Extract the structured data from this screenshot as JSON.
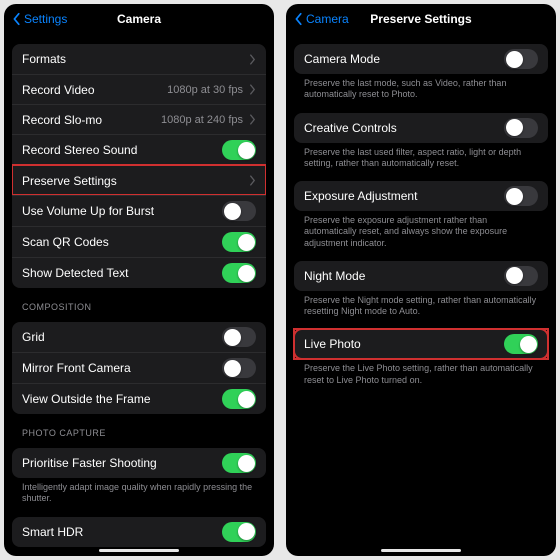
{
  "left": {
    "back": "Settings",
    "title": "Camera",
    "group1": [
      {
        "label": "Formats",
        "accessory": "chevron"
      },
      {
        "label": "Record Video",
        "value": "1080p at 30 fps",
        "accessory": "chevron"
      },
      {
        "label": "Record Slo-mo",
        "value": "1080p at 240 fps",
        "accessory": "chevron"
      },
      {
        "label": "Record Stereo Sound",
        "accessory": "toggle",
        "on": true
      },
      {
        "label": "Preserve Settings",
        "accessory": "chevron",
        "highlight": true
      },
      {
        "label": "Use Volume Up for Burst",
        "accessory": "toggle",
        "on": false
      },
      {
        "label": "Scan QR Codes",
        "accessory": "toggle",
        "on": true
      },
      {
        "label": "Show Detected Text",
        "accessory": "toggle",
        "on": true
      }
    ],
    "section2_header": "COMPOSITION",
    "group2": [
      {
        "label": "Grid",
        "accessory": "toggle",
        "on": false
      },
      {
        "label": "Mirror Front Camera",
        "accessory": "toggle",
        "on": false
      },
      {
        "label": "View Outside the Frame",
        "accessory": "toggle",
        "on": true
      }
    ],
    "section3_header": "PHOTO CAPTURE",
    "group3": [
      {
        "label": "Prioritise Faster Shooting",
        "accessory": "toggle",
        "on": true
      }
    ],
    "group3_footer": "Intelligently adapt image quality when rapidly pressing the shutter.",
    "group4": [
      {
        "label": "Smart HDR",
        "accessory": "toggle",
        "on": true
      }
    ]
  },
  "right": {
    "back": "Camera",
    "title": "Preserve Settings",
    "items": [
      {
        "label": "Camera Mode",
        "on": false,
        "desc": "Preserve the last mode, such as Video, rather than automatically reset to Photo."
      },
      {
        "label": "Creative Controls",
        "on": false,
        "desc": "Preserve the last used filter, aspect ratio, light or depth setting, rather than automatically reset."
      },
      {
        "label": "Exposure Adjustment",
        "on": false,
        "desc": "Preserve the exposure adjustment rather than automatically reset, and always show the exposure adjustment indicator."
      },
      {
        "label": "Night Mode",
        "on": false,
        "desc": "Preserve the Night mode setting, rather than automatically resetting Night mode to Auto."
      },
      {
        "label": "Live Photo",
        "on": true,
        "highlight": true,
        "desc": "Preserve the Live Photo setting, rather than automatically reset to Live Photo turned on."
      }
    ]
  }
}
